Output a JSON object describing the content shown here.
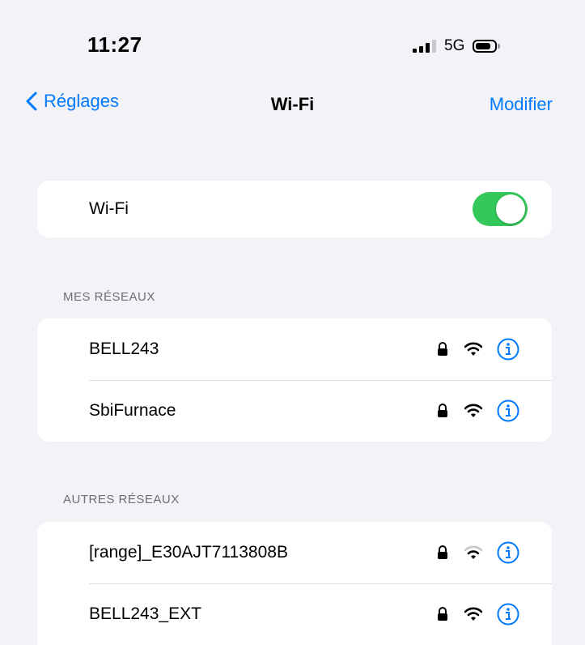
{
  "status_bar": {
    "time": "11:27",
    "network": "5G",
    "signal_bars_active": 3,
    "signal_bars_total": 4,
    "battery_level": 0.7
  },
  "nav": {
    "back_label": "Réglages",
    "title": "Wi-Fi",
    "edit_label": "Modifier"
  },
  "wifi_toggle": {
    "label": "Wi-Fi",
    "on": true
  },
  "my_networks": {
    "header": "MES RÉSEAUX",
    "items": [
      {
        "name": "BELL243",
        "secured": true
      },
      {
        "name": "SbiFurnace",
        "secured": true
      }
    ]
  },
  "other_networks": {
    "header": "AUTRES RÉSEAUX",
    "items": [
      {
        "name": "[range]_E30AJT7113808B",
        "secured": true
      },
      {
        "name": "BELL243_EXT",
        "secured": true
      }
    ]
  },
  "colors": {
    "accent": "#007aff",
    "toggle_on": "#34c759",
    "background": "#f2f2f7"
  }
}
